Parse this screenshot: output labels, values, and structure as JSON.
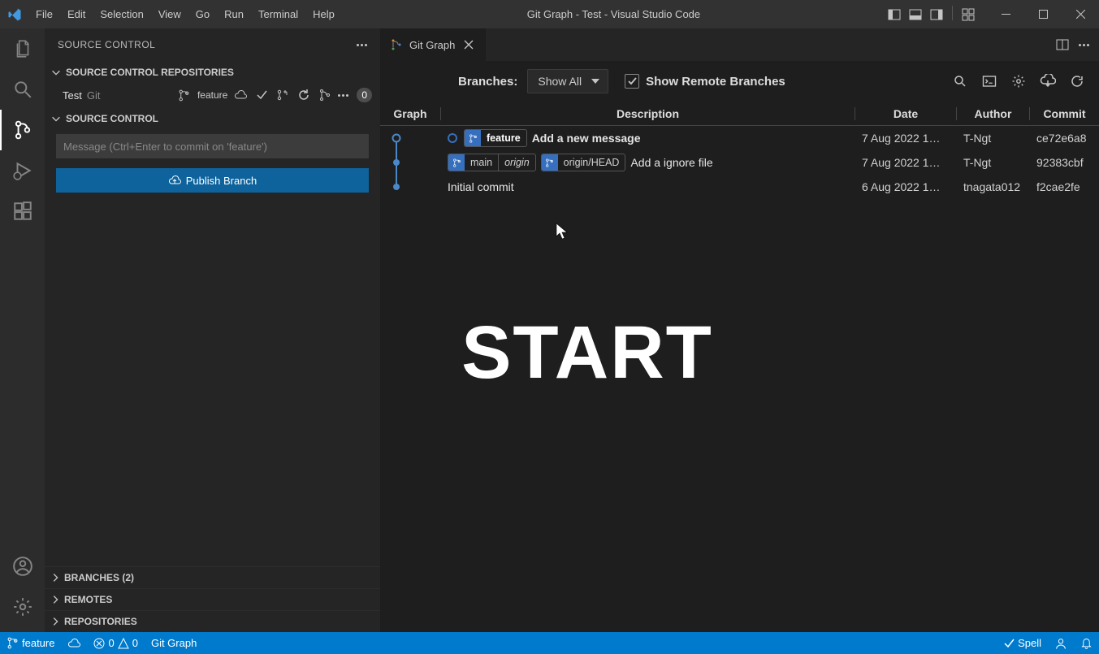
{
  "titlebar": {
    "title": "Git Graph - Test - Visual Studio Code",
    "menu": [
      "File",
      "Edit",
      "Selection",
      "View",
      "Go",
      "Run",
      "Terminal",
      "Help"
    ]
  },
  "sidebar": {
    "title": "SOURCE CONTROL",
    "repos_header": "SOURCE CONTROL REPOSITORIES",
    "scm_header": "SOURCE CONTROL",
    "repo": {
      "name": "Test",
      "type": "Git",
      "branch": "feature",
      "badge": "0"
    },
    "commit_placeholder": "Message (Ctrl+Enter to commit on 'feature')",
    "publish_label": "Publish Branch",
    "branches_section": "BRANCHES (2)",
    "remotes_section": "REMOTES",
    "repositories_section": "REPOSITORIES"
  },
  "tab": {
    "label": "Git Graph"
  },
  "gitgraph": {
    "branches_label": "Branches:",
    "branches_value": "Show All",
    "remote_label": "Show Remote Branches",
    "columns": {
      "graph": "Graph",
      "description": "Description",
      "date": "Date",
      "author": "Author",
      "commit": "Commit"
    },
    "rows": [
      {
        "head": true,
        "tags": [
          {
            "parts": [
              "feature"
            ],
            "head": true
          }
        ],
        "description": "Add a new message",
        "date": "7 Aug 2022 1…",
        "author": "T-Ngt",
        "commit": "ce72e6a8"
      },
      {
        "tags": [
          {
            "parts": [
              "main",
              "origin"
            ],
            "italicIndex": 1
          },
          {
            "parts": [
              "origin/HEAD"
            ]
          }
        ],
        "description": "Add a ignore file",
        "date": "7 Aug 2022 1…",
        "author": "T-Ngt",
        "commit": "92383cbf"
      },
      {
        "tags": [],
        "description": "Initial commit",
        "date": "6 Aug 2022 1…",
        "author": "tnagata012",
        "commit": "f2cae2fe"
      }
    ]
  },
  "overlay": {
    "start": "START"
  },
  "statusbar": {
    "branch": "feature",
    "errors": "0",
    "warnings": "0",
    "graph": "Git Graph",
    "spell": "Spell"
  }
}
